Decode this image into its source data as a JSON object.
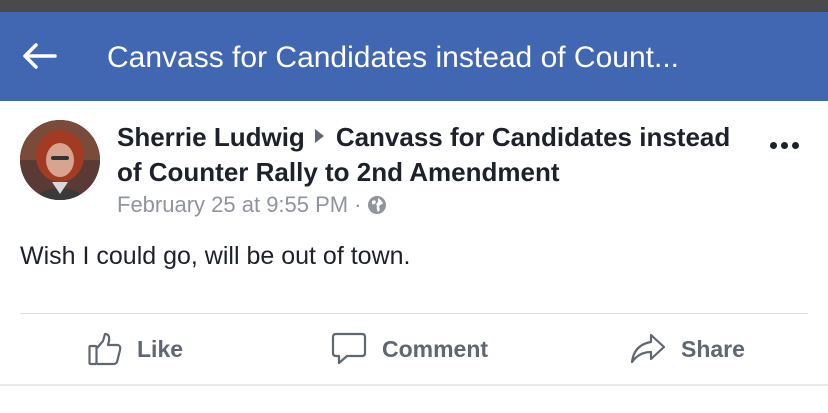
{
  "header": {
    "title": "Canvass for Candidates instead of Count...",
    "back_icon": "arrow-left-icon"
  },
  "post": {
    "author": "Sherrie Ludwig",
    "event_title": "Canvass for Candidates instead of Counter Rally to 2nd Amendment",
    "timestamp": "February 25 at 9:55 PM",
    "separator": "·",
    "privacy_icon": "globe-icon",
    "body": "Wish I could go, will be out of town."
  },
  "actions": {
    "like_label": "Like",
    "comment_label": "Comment",
    "share_label": "Share"
  },
  "colors": {
    "header_bg": "#4267b2",
    "text_primary": "#1d2129",
    "text_secondary": "#90949c",
    "action_text": "#606770"
  }
}
